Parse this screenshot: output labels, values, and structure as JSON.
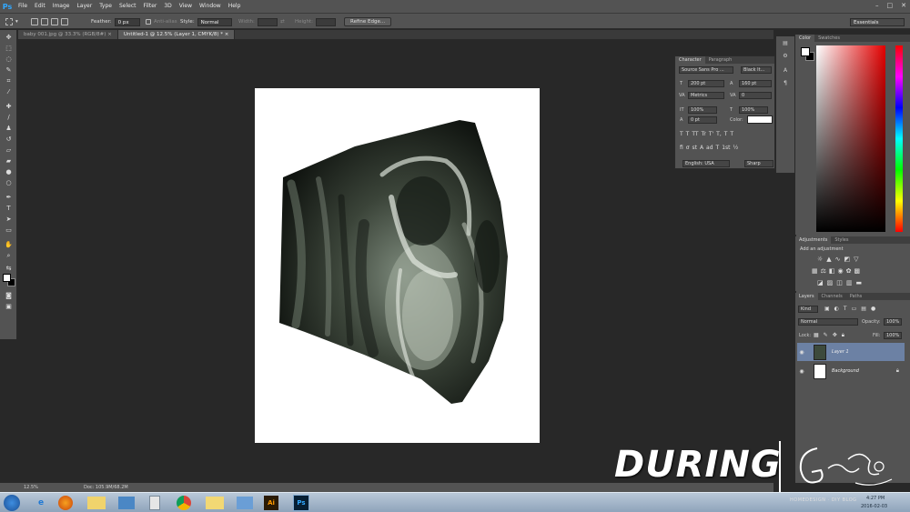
{
  "app": {
    "logo": "Ps",
    "menus": [
      "File",
      "Edit",
      "Image",
      "Layer",
      "Type",
      "Select",
      "Filter",
      "3D",
      "View",
      "Window",
      "Help"
    ]
  },
  "options": {
    "feather_label": "Feather:",
    "feather_value": "0 px",
    "antialias_label": "Anti-alias",
    "style_label": "Style:",
    "style_value": "Normal",
    "width_label": "Width:",
    "height_label": "Height:",
    "refine_edge": "Refine Edge...",
    "workspace": "Essentials"
  },
  "tabs": [
    {
      "label": "baby 001.jpg @ 33.3% (RGB/8#)",
      "active": false
    },
    {
      "label": "Untitled-1 @ 12.5% (Layer 1, CMYK/8) *",
      "active": true
    }
  ],
  "character": {
    "tabs": [
      "Character",
      "Paragraph"
    ],
    "font_family": "Source Sans Pro ...",
    "font_style": "Black It...",
    "size": "200 pt",
    "leading": "160 pt",
    "kerning": "Metrics",
    "tracking": "0",
    "vscale": "100%",
    "hscale": "100%",
    "baseline": "0 pt",
    "color_label": "Color:",
    "language": "English: USA",
    "aa": "Sharp",
    "style_glyphs": [
      "T",
      "T",
      "TT",
      "Tr",
      "T'",
      "T,",
      "T",
      "T"
    ],
    "ot_glyphs": [
      "fi",
      "ơ",
      "st",
      "A",
      "ad",
      "T",
      "1st",
      "½"
    ]
  },
  "color_panel": {
    "tabs": [
      "Color",
      "Swatches"
    ]
  },
  "adjustments": {
    "tabs": [
      "Adjustments",
      "Styles"
    ],
    "title": "Add an adjustment"
  },
  "layers_panel": {
    "tabs": [
      "Layers",
      "Channels",
      "Paths"
    ],
    "kind": "Kind",
    "blend": "Normal",
    "opacity_label": "Opacity:",
    "opacity": "100%",
    "lock_label": "Lock:",
    "fill_label": "Fill:",
    "fill": "100%",
    "layers": [
      {
        "name": "Layer 1",
        "selected": true
      },
      {
        "name": "Background",
        "selected": false
      }
    ]
  },
  "status": {
    "zoom": "12.5%",
    "doc": "Doc: 105.9M/68.2M"
  },
  "overlay": {
    "title": "DURING",
    "watermark": "HOMEDESIGN · DIY BLOG"
  },
  "taskbar": {
    "date": "2016-02-03",
    "time": "4:27 PM",
    "apps": [
      "IE",
      "Firefox",
      "Explorer",
      "Control",
      "Notes",
      "Chrome",
      "Folder",
      "Photos",
      "Ai",
      "Ps"
    ]
  },
  "colors": {
    "ui_bg": "#535353",
    "canvas_bg": "#282828",
    "accent": "#31a8ff",
    "layer_sel": "#6c81a4"
  }
}
